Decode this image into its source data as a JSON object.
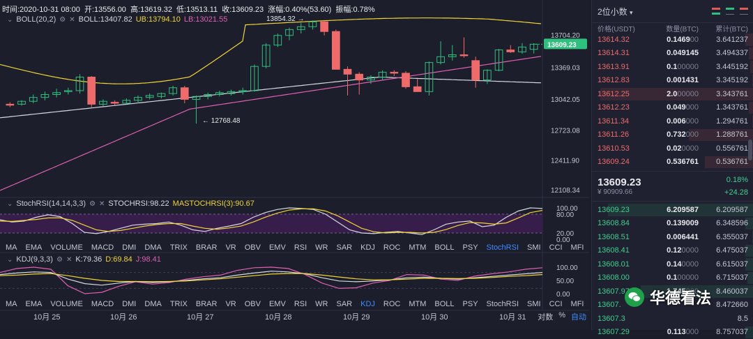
{
  "info": {
    "time_label": "时间:2020-10-31 08:00",
    "open_label": "开:",
    "open": "13556.00",
    "high_label": "高:",
    "high": "13619.32",
    "low_label": "低:",
    "low": "13513.11",
    "close_label": "收:",
    "close": "13609.23",
    "change_label": "涨幅:",
    "change": "0.40%(53.60)",
    "amp_label": "振幅:",
    "amp": "0.78%"
  },
  "boll": {
    "name": "BOLL(20,2)",
    "mid": "BOLL:13407.82",
    "ub": "UB:13794.10",
    "lb": "LB:13021.55"
  },
  "main_chart": {
    "y_ticks": [
      "13704.20",
      "13369.03",
      "13042.05",
      "12723.08",
      "12411.90",
      "12108.34"
    ],
    "y_tick_values": [
      13704.2,
      13369.03,
      13042.05,
      12723.08,
      12411.9,
      12108.34
    ],
    "current_price": "13609.23",
    "high_marker": "13854.32 →",
    "low_marker": "← 12768.48"
  },
  "stochrsi": {
    "name": "StochRSI(14,14,3,3)",
    "val": "STOCHRSI:98.22",
    "ma": "MASTOCHRSI(3):90.67",
    "y_ticks": [
      "100.00",
      "80.00",
      "20.00",
      "0.00"
    ]
  },
  "kdj": {
    "name": "KDJ(9,3,3)",
    "k": "K:79.36",
    "d": "D:69.84",
    "j": "J:98.41",
    "y_ticks": [
      "100.00",
      "50.00",
      "0.00"
    ]
  },
  "indicator_menu": [
    "MA",
    "EMA",
    "VOLUME",
    "MACD",
    "DMI",
    "DMA",
    "TRIX",
    "BRAR",
    "VR",
    "OBV",
    "EMV",
    "RSI",
    "WR",
    "SAR",
    "KDJ",
    "ROC",
    "MTM",
    "BOLL",
    "PSY",
    "StochRSI",
    "SMI",
    "CCI",
    "MFI",
    "ATR"
  ],
  "menu1_active": "StochRSI",
  "menu2_active": "KDJ",
  "dates": [
    "10月 25",
    "10月 26",
    "10月 27",
    "10月 28",
    "10月 29",
    "10月 30",
    "10月 31"
  ],
  "axis_opts": {
    "log": "对数",
    "pct": "%",
    "auto": "自动"
  },
  "orderbook": {
    "precision": "2位小数",
    "headers": [
      "价格(USDT)",
      "数量(BTC)",
      "累计(BTC)"
    ],
    "asks": [
      {
        "price": "13614.32",
        "qty_b": "0.1469",
        "qty_r": "00",
        "cum": "3.641237",
        "depth": 0.05
      },
      {
        "price": "13614.31",
        "qty_b": "0.049145",
        "qty_r": "",
        "cum": "3.494337",
        "depth": 0.03
      },
      {
        "price": "13613.91",
        "qty_b": "0.1",
        "qty_r": "00000",
        "cum": "3.445192",
        "depth": 0.02
      },
      {
        "price": "13612.83",
        "qty_b": "0.001431",
        "qty_r": "",
        "cum": "3.345192",
        "depth": 0.01
      },
      {
        "price": "13612.25",
        "qty_b": "2.0",
        "qty_r": "00000",
        "cum": "3.343761",
        "depth": 0.95
      },
      {
        "price": "13612.23",
        "qty_b": "0.049",
        "qty_r": "000",
        "cum": "1.343761",
        "depth": 0.03
      },
      {
        "price": "13611.34",
        "qty_b": "0.006",
        "qty_r": "000",
        "cum": "1.294761",
        "depth": 0.01
      },
      {
        "price": "13611.26",
        "qty_b": "0.732",
        "qty_r": "000",
        "cum": "1.288761",
        "depth": 0.4
      },
      {
        "price": "13610.53",
        "qty_b": "0.02",
        "qty_r": "0000",
        "cum": "0.556761",
        "depth": 0.02
      },
      {
        "price": "13609.24",
        "qty_b": "0.536761",
        "qty_r": "",
        "cum": "0.536761",
        "depth": 0.3
      }
    ],
    "last_price": "13609.23",
    "last_sub": "¥ 90909.66",
    "pct": "0.18%",
    "diff": "+24.28",
    "bids": [
      {
        "price": "13609.23",
        "qty_b": "6.209587",
        "qty_r": "",
        "cum": "6.209587",
        "depth": 0.9
      },
      {
        "price": "13608.84",
        "qty_b": "0.139009",
        "qty_r": "",
        "cum": "6.348596",
        "depth": 0.05
      },
      {
        "price": "13608.51",
        "qty_b": "0.006441",
        "qty_r": "",
        "cum": "6.355037",
        "depth": 0.01
      },
      {
        "price": "13608.41",
        "qty_b": "0.12",
        "qty_r": "0000",
        "cum": "6.475037",
        "depth": 0.05
      },
      {
        "price": "13608.01",
        "qty_b": "0.14",
        "qty_r": "0000",
        "cum": "6.615037",
        "depth": 0.05
      },
      {
        "price": "13608.00",
        "qty_b": "0.1",
        "qty_r": "00000",
        "cum": "6.715037",
        "depth": 0.04
      },
      {
        "price": "13607.97",
        "qty_b": "1.745",
        "qty_r": "000",
        "cum": "8.460037",
        "depth": 0.7
      },
      {
        "price": "13607.",
        "qty_b": "",
        "qty_r": "",
        "cum": "8.472660",
        "depth": 0.0
      },
      {
        "price": "13607.3",
        "qty_b": "",
        "qty_r": "",
        "cum": "8.5",
        "depth": 0.0
      },
      {
        "price": "13607.29",
        "qty_b": "0.113",
        "qty_r": "000",
        "cum": "8.757037",
        "depth": 0.05
      }
    ]
  },
  "watermark": "华德看法",
  "colors": {
    "up": "#2fbf7e",
    "down": "#ef6b6b",
    "boll_ub": "#f0d535",
    "boll_mid": "#d8dae2",
    "boll_lb": "#e05fb3",
    "accent": "#3d8bff"
  },
  "candles": [
    {
      "o": 12990,
      "h": 13010,
      "l": 12960,
      "c": 12980
    },
    {
      "o": 12990,
      "h": 13030,
      "l": 12975,
      "c": 13020
    },
    {
      "o": 13020,
      "h": 13090,
      "l": 13000,
      "c": 13060
    },
    {
      "o": 13060,
      "h": 13120,
      "l": 13030,
      "c": 13090
    },
    {
      "o": 13090,
      "h": 13150,
      "l": 13060,
      "c": 13110
    },
    {
      "o": 13120,
      "h": 13160,
      "l": 13090,
      "c": 13130
    },
    {
      "o": 13130,
      "h": 13300,
      "l": 13100,
      "c": 13270
    },
    {
      "o": 13270,
      "h": 13280,
      "l": 12960,
      "c": 12990
    },
    {
      "o": 12990,
      "h": 13040,
      "l": 12970,
      "c": 13020
    },
    {
      "o": 13010,
      "h": 13030,
      "l": 12980,
      "c": 13000
    },
    {
      "o": 13000,
      "h": 13050,
      "l": 12990,
      "c": 13030
    },
    {
      "o": 13030,
      "h": 13080,
      "l": 13000,
      "c": 13060
    },
    {
      "o": 13060,
      "h": 13100,
      "l": 13040,
      "c": 13080
    },
    {
      "o": 13070,
      "h": 13110,
      "l": 13050,
      "c": 13100
    },
    {
      "o": 13100,
      "h": 13180,
      "l": 13080,
      "c": 13160
    },
    {
      "o": 13160,
      "h": 13180,
      "l": 13000,
      "c": 13040
    },
    {
      "o": 13040,
      "h": 13080,
      "l": 12790,
      "c": 13070
    },
    {
      "o": 13070,
      "h": 13110,
      "l": 13040,
      "c": 13090
    },
    {
      "o": 13090,
      "h": 13130,
      "l": 13070,
      "c": 13110
    },
    {
      "o": 13100,
      "h": 13140,
      "l": 13080,
      "c": 13120
    },
    {
      "o": 13120,
      "h": 13160,
      "l": 13090,
      "c": 13130
    },
    {
      "o": 13130,
      "h": 13400,
      "l": 13120,
      "c": 13380
    },
    {
      "o": 13380,
      "h": 13620,
      "l": 13360,
      "c": 13600
    },
    {
      "o": 13600,
      "h": 13720,
      "l": 13580,
      "c": 13700
    },
    {
      "o": 13700,
      "h": 13780,
      "l": 13650,
      "c": 13760
    },
    {
      "o": 13760,
      "h": 13830,
      "l": 13720,
      "c": 13790
    },
    {
      "o": 13790,
      "h": 13854,
      "l": 13760,
      "c": 13840
    },
    {
      "o": 13840,
      "h": 13850,
      "l": 13700,
      "c": 13740
    },
    {
      "o": 13740,
      "h": 13760,
      "l": 13520,
      "c": 13350
    },
    {
      "o": 13350,
      "h": 13380,
      "l": 13080,
      "c": 13300
    },
    {
      "o": 13300,
      "h": 13320,
      "l": 13090,
      "c": 13240
    },
    {
      "o": 13240,
      "h": 13290,
      "l": 13200,
      "c": 13270
    },
    {
      "o": 13270,
      "h": 13340,
      "l": 13240,
      "c": 13320
    },
    {
      "o": 13320,
      "h": 13340,
      "l": 13280,
      "c": 13310
    },
    {
      "o": 13310,
      "h": 13330,
      "l": 13150,
      "c": 13170
    },
    {
      "o": 13170,
      "h": 13250,
      "l": 13120,
      "c": 13120
    },
    {
      "o": 13120,
      "h": 13430,
      "l": 13080,
      "c": 13420
    },
    {
      "o": 13420,
      "h": 13640,
      "l": 13400,
      "c": 13480
    },
    {
      "o": 13480,
      "h": 13600,
      "l": 13440,
      "c": 13500
    },
    {
      "o": 13500,
      "h": 13680,
      "l": 13470,
      "c": 13490
    },
    {
      "o": 13440,
      "h": 13480,
      "l": 13160,
      "c": 13240
    },
    {
      "o": 13240,
      "h": 13350,
      "l": 13200,
      "c": 13340
    },
    {
      "o": 13340,
      "h": 13560,
      "l": 13330,
      "c": 13550
    },
    {
      "o": 13550,
      "h": 13600,
      "l": 13520,
      "c": 13530
    },
    {
      "o": 13530,
      "h": 13620,
      "l": 13510,
      "c": 13580
    },
    {
      "o": 13556,
      "h": 13619,
      "l": 13513,
      "c": 13609
    }
  ],
  "stoch_k": [
    62,
    55,
    58,
    70,
    78,
    72,
    50,
    22,
    18,
    25,
    35,
    45,
    48,
    50,
    55,
    45,
    30,
    25,
    35,
    42,
    50,
    70,
    85,
    95,
    100,
    98,
    95,
    80,
    55,
    30,
    20,
    18,
    22,
    25,
    20,
    15,
    30,
    48,
    55,
    58,
    40,
    45,
    70,
    90,
    100,
    98
  ],
  "stoch_d": [
    58,
    57,
    60,
    63,
    68,
    68,
    60,
    45,
    30,
    25,
    28,
    35,
    42,
    47,
    50,
    50,
    42,
    35,
    32,
    36,
    42,
    55,
    70,
    83,
    93,
    97,
    97,
    90,
    75,
    55,
    35,
    24,
    20,
    22,
    22,
    20,
    22,
    31,
    44,
    53,
    52,
    48,
    52,
    68,
    85,
    92
  ],
  "kdj_k": [
    72,
    78,
    82,
    80,
    55,
    38,
    32,
    40,
    46,
    42,
    45,
    50,
    56,
    60,
    70,
    78,
    85,
    82,
    75,
    60,
    48,
    45,
    48,
    52,
    60,
    62,
    58,
    55,
    60,
    65,
    70,
    75,
    80
  ],
  "kdj_d": [
    68,
    70,
    74,
    76,
    68,
    58,
    50,
    46,
    46,
    45,
    46,
    48,
    52,
    56,
    62,
    68,
    74,
    76,
    76,
    70,
    63,
    56,
    52,
    52,
    55,
    58,
    58,
    57,
    58,
    61,
    65,
    68,
    72
  ],
  "kdj_j": [
    80,
    95,
    100,
    92,
    30,
    0,
    5,
    28,
    45,
    36,
    42,
    55,
    64,
    70,
    88,
    98,
    100,
    95,
    72,
    40,
    20,
    22,
    40,
    50,
    72,
    70,
    55,
    50,
    66,
    75,
    82,
    92,
    98
  ]
}
